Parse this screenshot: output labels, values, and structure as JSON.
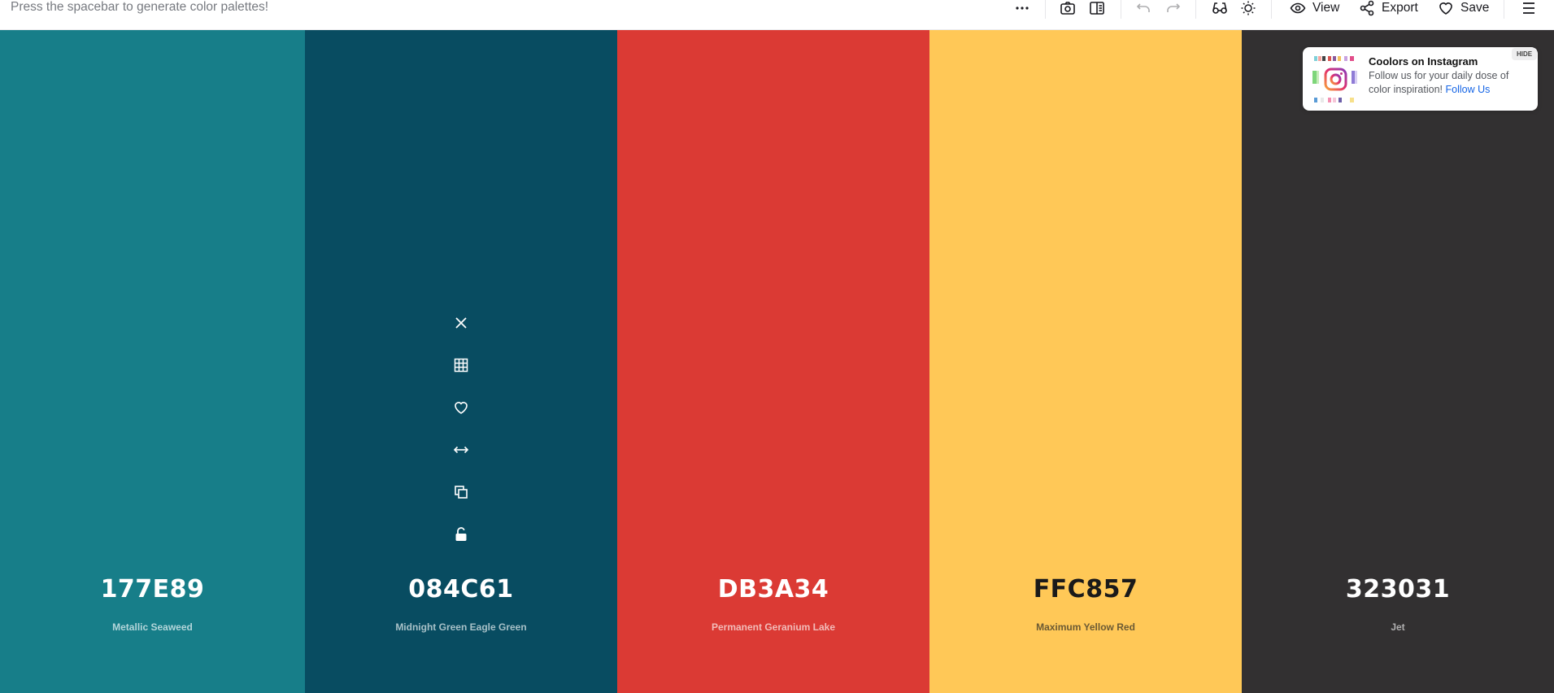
{
  "toolbar": {
    "hint": "Press the spacebar to generate color palettes!",
    "view_label": "View",
    "export_label": "Export",
    "save_label": "Save"
  },
  "palette": [
    {
      "hex": "177E89",
      "name": "Metallic Seaweed",
      "color": "#177E89",
      "text_color": "#ffffff",
      "name_color": "#b4d6da"
    },
    {
      "hex": "084C61",
      "name": "Midnight Green Eagle Green",
      "color": "#084C61",
      "text_color": "#ffffff",
      "name_color": "#a8c1c8"
    },
    {
      "hex": "DB3A34",
      "name": "Permanent Geranium Lake",
      "color": "#DB3A34",
      "text_color": "#ffffff",
      "name_color": "#f2bdba"
    },
    {
      "hex": "FFC857",
      "name": "Maximum Yellow Red",
      "color": "#FFC857",
      "text_color": "#1a1a1a",
      "name_color": "#6b5a34"
    },
    {
      "hex": "323031",
      "name": "Jet",
      "color": "#323031",
      "text_color": "#ffffff",
      "name_color": "#b0afb0"
    }
  ],
  "swatch_tools": [
    "close-icon",
    "grid-icon",
    "heart-icon",
    "drag-arrows-icon",
    "copy-icon",
    "unlock-icon"
  ],
  "promo": {
    "title": "Coolors on Instagram",
    "text": "Follow us for your daily dose of color inspiration! ",
    "link": "Follow Us",
    "hide": "HIDE"
  }
}
